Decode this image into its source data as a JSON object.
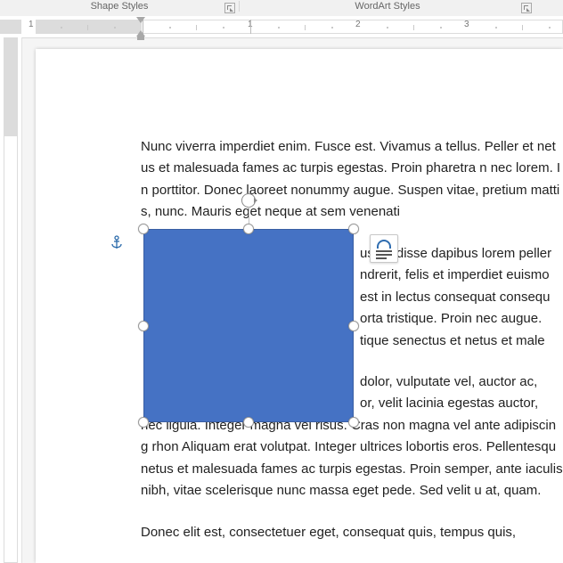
{
  "ribbon": {
    "shape_styles": "Shape Styles",
    "wordart_styles": "WordArt Styles"
  },
  "ruler": {
    "n1": "1",
    "n2": "2",
    "n3": "3"
  },
  "doc": {
    "p1": "Nunc viverra imperdiet enim. Fusce est. Vivamus a tellus. Peller et netus et malesuada fames ac turpis egestas. Proin pharetra n nec lorem. In porttitor. Donec laoreet nonummy augue. Suspen vitae, pretium mattis, nunc. Mauris eget neque at sem venenati",
    "p2a": "uspendisse dapibus lorem peller",
    "p2b": "ndrerit, felis et imperdiet euismo",
    "p2c": "est in lectus consequat consequ",
    "p2d": "orta tristique. Proin nec augue.",
    "p2e": "tique senectus et netus et male",
    "p3a": "dolor, vulputate vel, auctor ac,",
    "p3b": "or, velit lacinia egestas auctor,",
    "p3c": "nec ligula. Integer magna vel risus. Cras non magna vel ante adipiscing rhon Aliquam erat volutpat. Integer ultrices lobortis eros. Pellentesqu netus et malesuada fames ac turpis egestas. Proin semper, ante iaculis nibh, vitae scelerisque nunc massa eget pede. Sed velit u at, quam.",
    "p4": "Donec elit est, consectetuer eget, consequat quis, tempus quis,"
  }
}
